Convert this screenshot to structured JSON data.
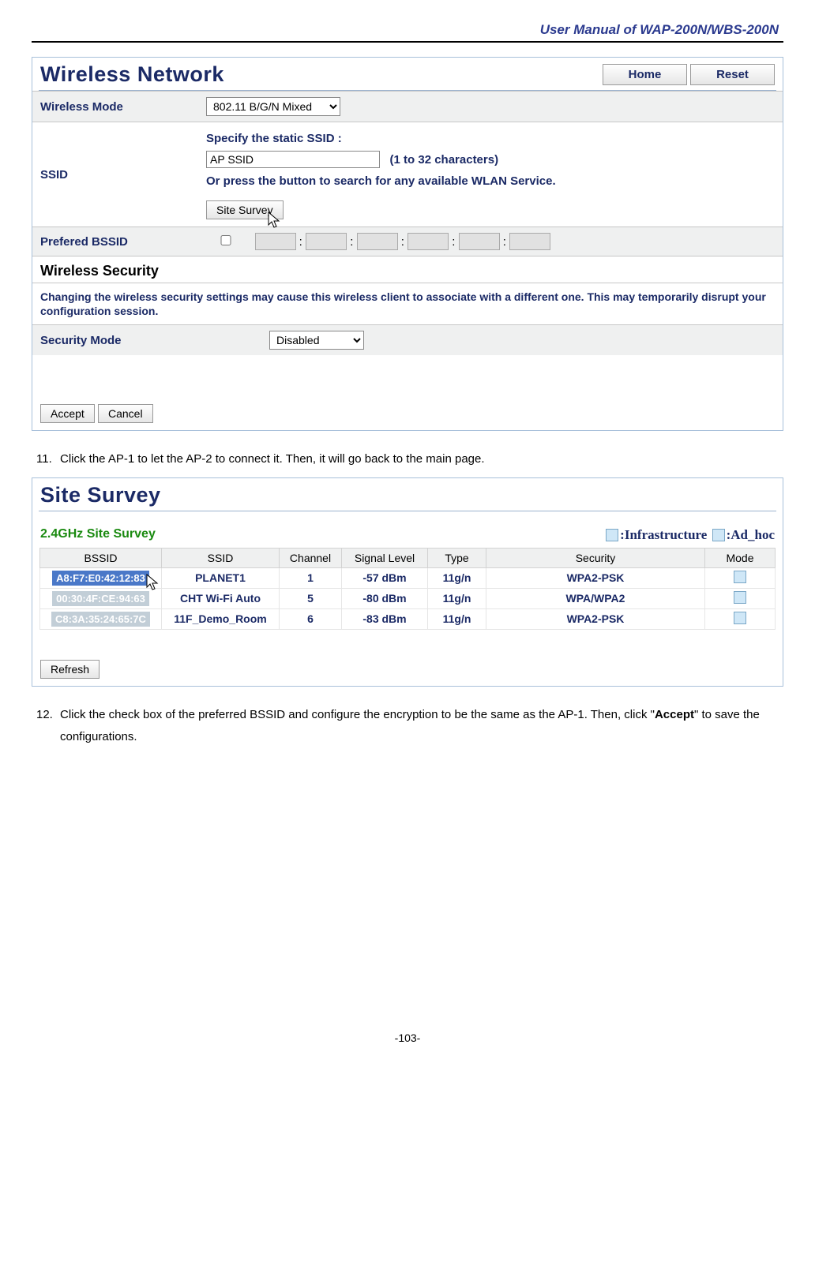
{
  "doc": {
    "header": "User Manual of WAP-200N/WBS-200N",
    "page_no": "-103-"
  },
  "panel1": {
    "title": "Wireless Network",
    "home": "Home",
    "reset": "Reset",
    "rows": {
      "wireless_mode_label": "Wireless Mode",
      "wireless_mode_value": "802.11 B/G/N Mixed",
      "ssid_label": "SSID",
      "ssid_static_prompt": "Specify the static SSID  :",
      "ssid_value": "AP SSID",
      "ssid_hint": "(1 to 32 characters)",
      "ssid_or": "Or press the button to search for any available WLAN Service.",
      "site_survey_btn": "Site Survey",
      "pref_bssid_label": "Prefered BSSID"
    },
    "security_title": "Wireless Security",
    "security_warning": "Changing the wireless security settings may cause this wireless client to associate with a different one. This may temporarily disrupt your configuration session.",
    "security_mode_label": "Security Mode",
    "security_mode_value": "Disabled",
    "accept": "Accept",
    "cancel": "Cancel"
  },
  "step11": {
    "num": "11.",
    "text": "Click the AP-1 to let the AP-2 to connect it. Then, it will go back to the main page."
  },
  "panel2": {
    "title": "Site Survey",
    "freq": "2.4GHz Site Survey",
    "legend_infra": ":Infrastructure",
    "legend_adhoc": ":Ad_hoc",
    "headers": {
      "bssid": "BSSID",
      "ssid": "SSID",
      "channel": "Channel",
      "signal": "Signal Level",
      "type": "Type",
      "security": "Security",
      "mode": "Mode"
    },
    "rows": [
      {
        "bssid": "A8:F7:E0:42:12:83",
        "ssid": "PLANET1",
        "channel": "1",
        "signal": "-57 dBm",
        "type": "11g/n",
        "security": "WPA2-PSK",
        "dim": false
      },
      {
        "bssid": "00:30:4F:CE:94:63",
        "ssid": "CHT Wi-Fi Auto",
        "channel": "5",
        "signal": "-80 dBm",
        "type": "11g/n",
        "security": "WPA/WPA2",
        "dim": true
      },
      {
        "bssid": "C8:3A:35:24:65:7C",
        "ssid": "11F_Demo_Room",
        "channel": "6",
        "signal": "-83 dBm",
        "type": "11g/n",
        "security": "WPA2-PSK",
        "dim": true
      }
    ],
    "refresh": "Refresh"
  },
  "step12": {
    "num": "12.",
    "text_a": "Click the check box of the preferred BSSID and configure the encryption to be the same as the AP-1. Then, click \"",
    "bold": "Accept",
    "text_b": "\" to save the configurations."
  }
}
